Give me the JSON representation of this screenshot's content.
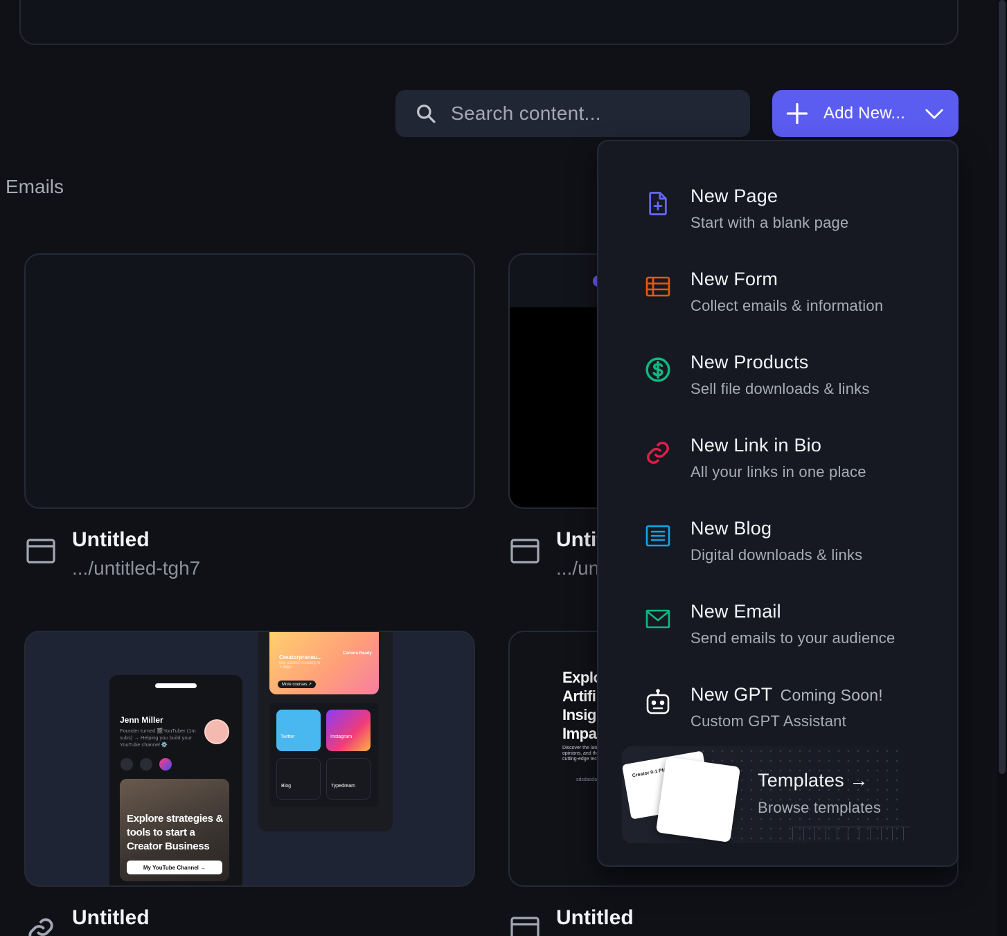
{
  "search": {
    "placeholder": "Search content..."
  },
  "add_button": {
    "label": "Add New..."
  },
  "section": {
    "title": "Emails"
  },
  "cards": [
    {
      "title": "Untitled",
      "slug": ".../untitled-tgh7"
    },
    {
      "title": "Untit",
      "slug": ".../un"
    },
    {
      "title": "Untitled"
    },
    {
      "title": "Untitled"
    }
  ],
  "card_previews": {
    "profile": {
      "name": "Jenn Miller",
      "bio": "Founder turned 🎬YouTuber (1m subs) → Helping you build your YouTube channel ⚙️",
      "headline": "Explore strategies & tools to start a Creator Business",
      "cta": "My YouTube Channel →"
    },
    "tablet": {
      "course_title": "Creatorpreneu...",
      "course_sub": "Get started creating in 7 days",
      "course_badge": "Camera Ready",
      "more": "More courses ↗",
      "tiles": [
        "Twitter",
        "Instagram",
        "Blog",
        "Typedream"
      ]
    },
    "blog": {
      "headline_lines": [
        "Explo",
        "Artifi",
        "Insig",
        "Impa"
      ],
      "sub": "Discover the late opinions, and tho cutting-edge tec",
      "tag": "sdsdasdas"
    }
  },
  "dropdown": {
    "items": [
      {
        "title": "New Page",
        "subtitle": "Start with a blank page",
        "icon": "file-plus-icon",
        "color": "#6366f1"
      },
      {
        "title": "New Form",
        "subtitle": "Collect emails & information",
        "icon": "form-icon",
        "color": "#ea580c"
      },
      {
        "title": "New Products",
        "subtitle": "Sell file downloads & links",
        "icon": "dollar-circle-icon",
        "color": "#10b981"
      },
      {
        "title": "New Link in Bio",
        "subtitle": "All your links in one place",
        "icon": "link-icon",
        "color": "#e11d48"
      },
      {
        "title": "New Blog",
        "subtitle": "Digital downloads & links",
        "icon": "newspaper-icon",
        "color": "#0ea5e9"
      },
      {
        "title": "New Email",
        "subtitle": "Send emails to your audience",
        "icon": "mail-icon",
        "color": "#10b981"
      },
      {
        "title": "New GPT",
        "badge": "Coming Soon!",
        "subtitle": "Custom GPT Assistant",
        "icon": "robot-icon",
        "color": "#ffffff"
      }
    ],
    "templates": {
      "title": "Templates →",
      "subtitle": "Browse templates",
      "preview_card": "Creator 0-1 Playbook"
    }
  },
  "colors": {
    "accent": "#5b5cf0",
    "background": "#0f1117",
    "panel": "#161922"
  }
}
